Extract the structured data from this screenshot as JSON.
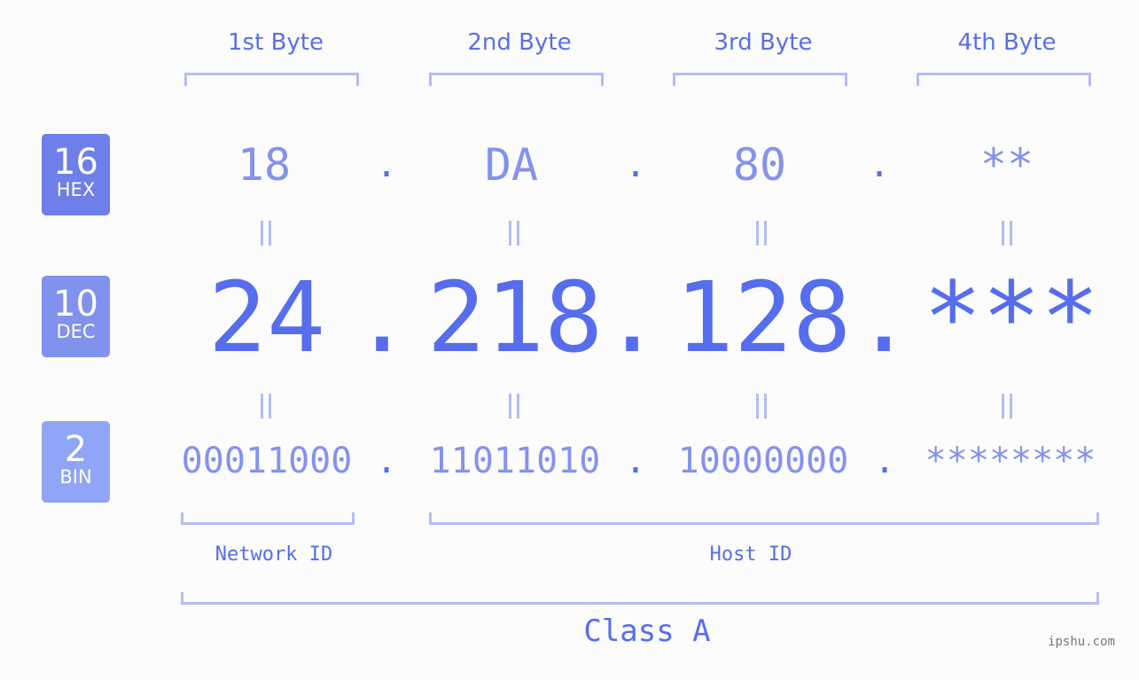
{
  "bytes": {
    "headers": [
      "1st Byte",
      "2nd Byte",
      "3rd Byte",
      "4th Byte"
    ]
  },
  "rows": {
    "hex": {
      "base": "16",
      "label": "HEX",
      "values": [
        "18",
        "DA",
        "80",
        "**"
      ],
      "color": "#6e7fe9"
    },
    "dec": {
      "base": "10",
      "label": "DEC",
      "values": [
        "24",
        "218",
        "128",
        "***"
      ],
      "color": "#8091ee"
    },
    "bin": {
      "base": "2",
      "label": "BIN",
      "values": [
        "00011000",
        "11011010",
        "10000000",
        "********"
      ],
      "color": "#8fa5f6"
    }
  },
  "separator": ".",
  "sections": {
    "network_id": "Network ID",
    "host_id": "Host ID",
    "class": "Class A"
  },
  "watermark": "ipshu.com"
}
